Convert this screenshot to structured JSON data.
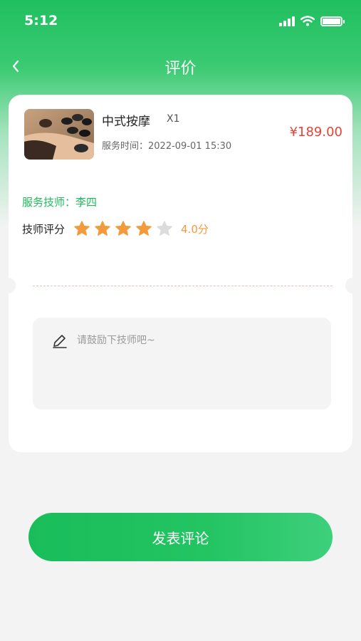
{
  "status_bar": {
    "time": "5:12"
  },
  "nav": {
    "title": "评价"
  },
  "order": {
    "service_name": "中式按摩",
    "quantity": "X1",
    "service_time": "服务时间：2022-09-01 15:30",
    "price": "¥189.00"
  },
  "technician": {
    "label": "服务技师：李四",
    "rating_label": "技师评分",
    "rating_value": 4,
    "rating_max": 5,
    "score_text": "4.0分"
  },
  "comment": {
    "placeholder": "请鼓励下技师吧~",
    "value": ""
  },
  "submit_label": "发表评论",
  "colors": {
    "brand_green": "#1dbb5b",
    "price_red": "#e64336",
    "star_active": "#f29a3c",
    "star_inactive": "#dcdcdc"
  },
  "icons": [
    "back-chevron-icon",
    "signal-icon",
    "wifi-icon",
    "battery-icon",
    "star-icon",
    "pencil-icon"
  ]
}
